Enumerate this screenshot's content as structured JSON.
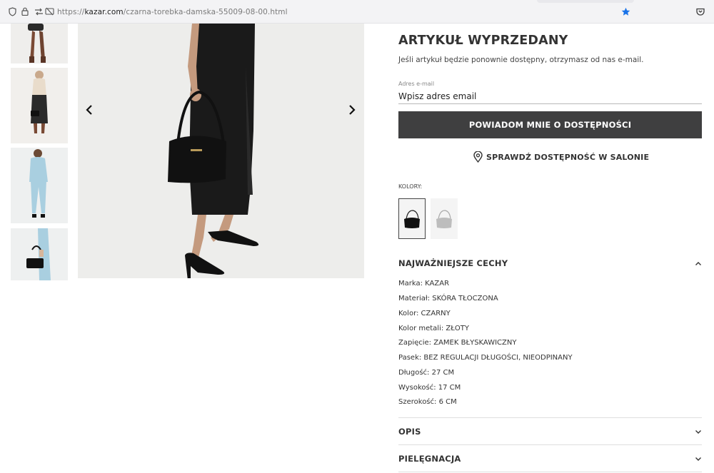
{
  "browser": {
    "url_prefix": "https://",
    "url_host": "kazar.com",
    "url_path": "/czarna-torebka-damska-55009-08-00.html"
  },
  "product": {
    "title": "ARTYKUŁ WYPRZEDANY",
    "subtitle": "Jeśli artykuł będzie ponownie dostępny, otrzymasz od nas e-mail.",
    "email_label": "Adres e-mail",
    "email_placeholder": "Wpisz adres email",
    "notify_button": "POWIADOM MNIE O DOSTĘPNOŚCI",
    "store_check": "SPRAWDŹ DOSTĘPNOŚĆ W SALONIE",
    "colors_label": "KOLORY:"
  },
  "features": {
    "heading": "NAJWAŻNIEJSZE CECHY",
    "items": [
      "Marka: KAZAR",
      "Materiał: SKÓRA TŁOCZONA",
      "Kolor: CZARNY",
      "Kolor metali: ZŁOTY",
      "Zapięcie: ZAMEK BŁYSKAWICZNY",
      "Pasek: BEZ REGULACJI DŁUGOŚCI, NIEODPINANY",
      "Długość: 27 CM",
      "Wysokość: 17 CM",
      "Szerokość: 6 CM"
    ]
  },
  "sections": {
    "description": "OPIS",
    "care": "PIELĘGNACJA"
  },
  "icons": {
    "shield": "shield-icon",
    "lock": "lock-icon",
    "permissions": "permissions-icon",
    "tracking": "tracking-protection-icon",
    "bookmark": "bookmark-star-icon",
    "pocket": "pocket-icon",
    "prev": "chevron-left-icon",
    "next": "chevron-right-icon",
    "location": "location-pin-icon",
    "collapse": "chevron-up-icon",
    "expand": "chevron-down-icon"
  },
  "colors": {
    "button_bg": "#3f3f40",
    "bookmark_star": "#1a73e8",
    "pocket": "#3d3d3d"
  }
}
